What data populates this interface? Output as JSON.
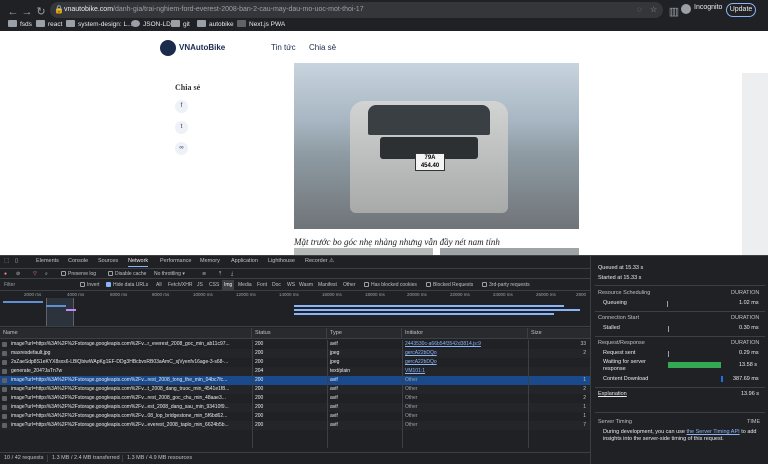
{
  "browser": {
    "url_host": "vnautobike.com",
    "url_path": "/danh-gia/trai-nghiem-ford-everest-2008-ban-2-cau-may-dau-mo-uoc-mot-thoi-17",
    "incognito_label": "Incognito",
    "update_label": "Update",
    "bookmarks": [
      "fsds",
      "react",
      "system-design: L...",
      "JSON-LD",
      "git",
      "autobike",
      "Next.js PWA"
    ]
  },
  "page": {
    "logo": "VNAutoBike",
    "menu": [
      "Tin tức",
      "Chia sẻ"
    ],
    "share_title": "Chia sẻ",
    "plate": "79A\n454.40",
    "caption": "Mặt trước bo góc nhẹ nhàng nhưng vẫn đầy nét nam tính"
  },
  "devtools": {
    "tabs": [
      "Elements",
      "Console",
      "Sources",
      "Network",
      "Performance",
      "Memory",
      "Application",
      "Lighthouse",
      "Recorder ⚠"
    ],
    "toolbar": {
      "preserve_log": "Preserve log",
      "disable_cache": "Disable cache",
      "throttling": "No throttling"
    },
    "filters": {
      "filter_placeholder": "Filter",
      "invert": "Invert",
      "hide_data_urls": "Hide data URLs",
      "types": [
        "All",
        "Fetch/XHR",
        "JS",
        "CSS",
        "Img",
        "Media",
        "Font",
        "Doc",
        "WS",
        "Wasm",
        "Manifest",
        "Other"
      ],
      "selected_type": "Img",
      "blocked_cookies": "Has blocked cookies",
      "blocked_requests": "Blocked Requests",
      "third_party": "3rd-party requests"
    },
    "overview_ticks": [
      "2000 ms",
      "4000 ms",
      "6000 ms",
      "8000 ms",
      "10000 ms",
      "12000 ms",
      "14000 ms",
      "16000 ms",
      "18000 ms",
      "20000 ms",
      "22000 ms",
      "24000 ms",
      "26000 ms",
      "2800"
    ],
    "columns": [
      "Name",
      "Status",
      "Type",
      "Initiator",
      "Size"
    ],
    "rows": [
      {
        "name": "image?url=https%3A%2F%2Fstorage.googleapis.com%2Fv...r_everest_2008_goc_min_ab11c97...",
        "status": "200",
        "type": "avif",
        "initiator": "2443530c-a66b54f3542d3814.js:9",
        "initiator_link": true,
        "size": "33"
      },
      {
        "name": "maxresdefault.jpg",
        "status": "200",
        "type": "jpeg",
        "initiator": "gercA22bDQo",
        "initiator_link": true,
        "size": "2"
      },
      {
        "name": "2sZaeSdp8S1eKYX8sxs6-LBlQbiwWApKg1EF-DDg3HBcbvxRB03aAmC_sjVyenfv16age-3-s68-...",
        "status": "200",
        "type": "jpeg",
        "initiator": "gercA22bDQo",
        "initiator_link": true,
        "size": ""
      },
      {
        "name": "generate_204?JaTn7w",
        "status": "204",
        "type": "text/plain",
        "initiator": "VM101:1",
        "initiator_link": true,
        "size": ""
      },
      {
        "name": "image?url=https%3A%2F%2Fstorage.googleapis.com%2Fv...rest_2008_tong_the_min_04bc7fc...",
        "status": "200",
        "type": "avif",
        "initiator": "Other",
        "initiator_link": false,
        "size": "1",
        "selected": true
      },
      {
        "name": "image?url=https%3A%2F%2Fstorage.googleapis.com%2Fv...t_2008_dang_truoc_min_4541e1f8...",
        "status": "200",
        "type": "avif",
        "initiator": "Other",
        "initiator_link": false,
        "size": "2"
      },
      {
        "name": "image?url=https%3A%2F%2Fstorage.googleapis.com%2Fv...rest_2008_goc_chu_min_48aae3...",
        "status": "200",
        "type": "avif",
        "initiator": "Other",
        "initiator_link": false,
        "size": "2"
      },
      {
        "name": "image?url=https%3A%2F%2Fstorage.googleapis.com%2Fv...est_2008_dang_sau_min_93410f9...",
        "status": "200",
        "type": "avif",
        "initiator": "Other",
        "initiator_link": false,
        "size": "1"
      },
      {
        "name": "image?url=https%3A%2F%2Fstorage.googleapis.com%2Fv...08_lop_bridgestone_min_5f6bd62...",
        "status": "200",
        "type": "avif",
        "initiator": "Other",
        "initiator_link": false,
        "size": "1"
      },
      {
        "name": "image?url=https%3A%2F%2Fstorage.googleapis.com%2Fv...everest_2008_taplo_min_6624b5b...",
        "status": "200",
        "type": "avif",
        "initiator": "Other",
        "initiator_link": false,
        "size": "7"
      }
    ],
    "status_bar": {
      "requests": "10 / 42 requests",
      "transferred": "1.3 MB / 2.4 MB transferred",
      "resources": "1.3 MB / 4.9 MB resources"
    },
    "timing": {
      "queued_at": "Queued at 15.33 s",
      "started_at": "Started at 15.33 s",
      "resource_scheduling": "Resource Scheduling",
      "duration_label": "DURATION",
      "queueing": "Queueing",
      "queueing_value": "1.02 ms",
      "connection_start": "Connection Start",
      "stalled": "Stalled",
      "stalled_value": "0.30 ms",
      "request_response": "Request/Response",
      "request_sent": "Request sent",
      "request_sent_value": "0.29 ms",
      "waiting": "Waiting for server response",
      "waiting_value": "13.58 s",
      "content_download": "Content Download",
      "content_download_value": "387.69 ms",
      "explanation": "Explanation",
      "total": "13.96 s",
      "server_timing": "Server Timing",
      "time_label": "TIME",
      "server_note_pre": "During development, you can use ",
      "server_note_link": "the Server Timing API",
      "server_note_post": " to add insights into the server-side timing of this request."
    }
  }
}
